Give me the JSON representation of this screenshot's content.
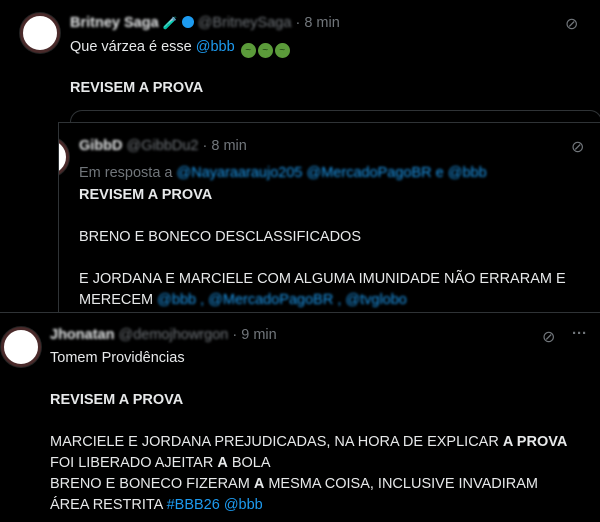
{
  "tweet1": {
    "name": "Britney Saga",
    "name_emoji": "🧪",
    "handle": "@BritneySaga",
    "separator": "·",
    "time": "8 min",
    "text_line1": "Que várzea é esse ",
    "mention": "@bbb",
    "emojis": [
      "🤢",
      "🤢",
      "🤢"
    ],
    "text_line2": "REVISEM A PROVA"
  },
  "tweet2": {
    "name": "GibbD",
    "handle": "@GibbDu2",
    "separator": "·",
    "time": "8 min",
    "reply_prefix": "Em resposta a ",
    "reply_mentions": "@Nayaraaraujo205 @MercadoPagoBR e @bbb",
    "line1": "REVISEM A PROVA",
    "line2": "BRENO E BONECO DESCLASSIFICADOS",
    "line3": "E JORDANA E MARCIELE COM ALGUMA IMUNIDADE NÃO ERRARAM E",
    "line4_prefix": "MERECEM ",
    "line4_mentions": "@bbb , @MercadoPagoBR , @tvglobo"
  },
  "tweet3": {
    "name": "Jhonatan",
    "handle": "@demojhowrgon",
    "separator": "·",
    "time": "9 min",
    "line1": "Tomem Providências",
    "line2": "REVISEM A PROVA",
    "line3a": "MARCIELE E JORDANA PREJUDICADAS, NA HORA DE EXPLICAR ",
    "line3b": "A PROVA",
    "line4a": "FOI LIBERADO AJEITAR ",
    "line4b": "A",
    "line4c": " BOLA",
    "line5a": "BRENO E BONECO FIZERAM ",
    "line5b": "A",
    "line5c": " MESMA COISA, INCLUSIVE INVADIRAM",
    "line6a": "ÁREA RESTRITA ",
    "hashtag": "#BBB26",
    "line6_mention": "@bbb",
    "more": "···"
  },
  "icons": {
    "grok": "⊘"
  }
}
